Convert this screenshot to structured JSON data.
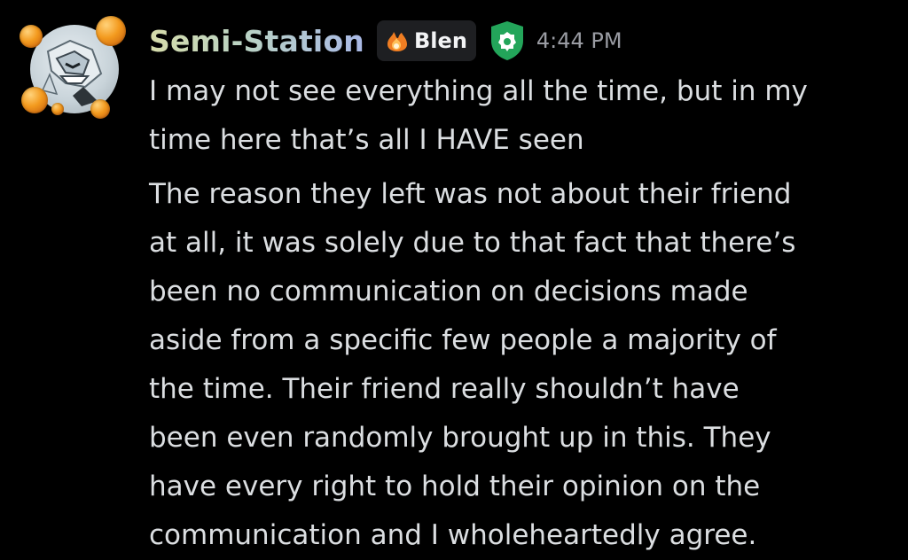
{
  "message": {
    "author": {
      "username": "Semi-Station",
      "clan_tag": "Blen",
      "avatar_icon": "pokemon-avatar-with-dragon-balls",
      "badge_icon": "shield-icon"
    },
    "timestamp": "4:44 PM",
    "paragraphs": [
      "I may not see everything all the time, but in my\ntime here that’s all I HAVE seen",
      "The reason they left was not about their friend\nat all, it was solely due to that fact that there’s\nbeen no communication on decisions made\naside from a specific few people a majority of\nthe time. Their friend really shouldn’t have\nbeen even randomly brought up in this. They\nhave every right to hold their opinion on the\ncommunication and I wholeheartedly agree."
    ]
  },
  "colors": {
    "background": "#000000",
    "text": "#dbdee1",
    "timestamp": "#9a9ca3",
    "username_gradient_start": "#d6dcaa",
    "username_gradient_end": "#a9b9e6",
    "shield": "#23a55a",
    "clan_tag_bg": "#1e1f22"
  }
}
